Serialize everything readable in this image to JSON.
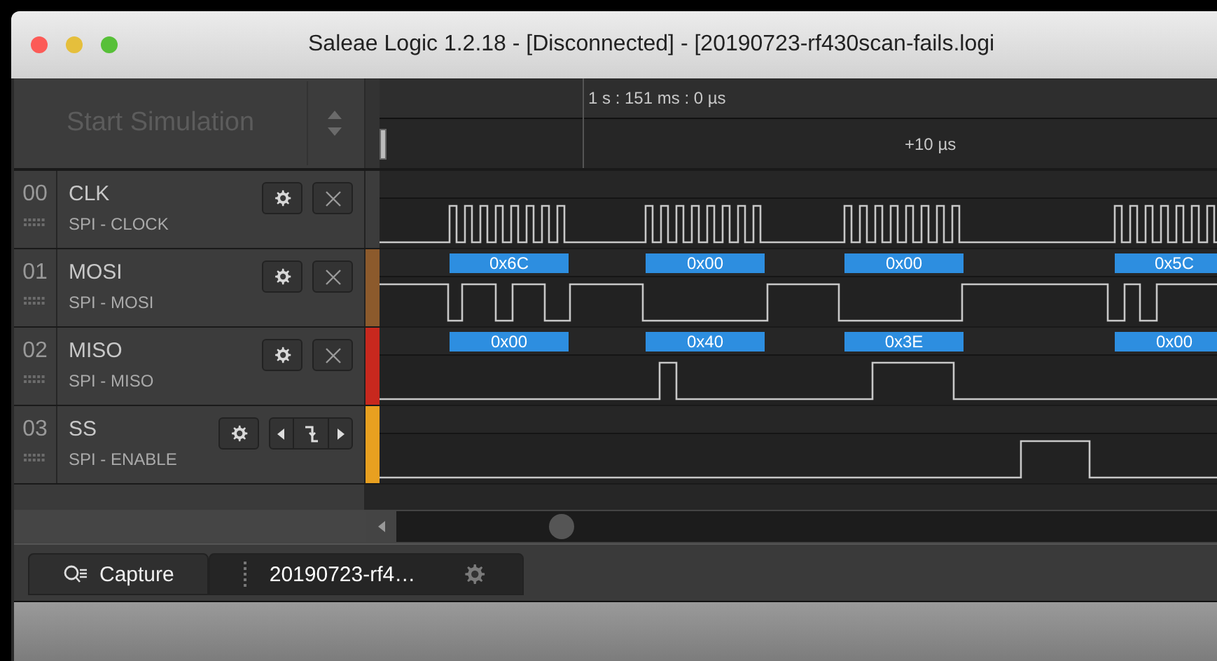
{
  "window": {
    "title": "Saleae Logic 1.2.18 - [Disconnected] - [20190723-rf430scan-fails.logi"
  },
  "simulation_button": {
    "label": "Start Simulation",
    "disabled": true
  },
  "timeline": {
    "cursor_time": "1 s : 151 ms : 0 µs",
    "offset": "+10 µs"
  },
  "channels": [
    {
      "number": "00",
      "name": "CLK",
      "analyzer": "SPI - CLOCK",
      "color": "#3c3c3c",
      "kind": "clock"
    },
    {
      "number": "01",
      "name": "MOSI",
      "analyzer": "SPI - MOSI",
      "color": "#8c5a2c",
      "kind": "mosi",
      "decoded": [
        "0x6C",
        "0x00",
        "0x00",
        "0x5C"
      ]
    },
    {
      "number": "02",
      "name": "MISO",
      "analyzer": "SPI - MISO",
      "color": "#c8281e",
      "kind": "miso",
      "decoded": [
        "0x00",
        "0x40",
        "0x3E",
        "0x00"
      ]
    },
    {
      "number": "03",
      "name": "SS",
      "analyzer": "SPI - ENABLE",
      "color": "#e8a020",
      "kind": "enable"
    }
  ],
  "tabs": [
    {
      "label": "Capture",
      "kind": "capture",
      "selected": false
    },
    {
      "label": "20190723-rf4…",
      "kind": "document",
      "selected": true
    }
  ]
}
